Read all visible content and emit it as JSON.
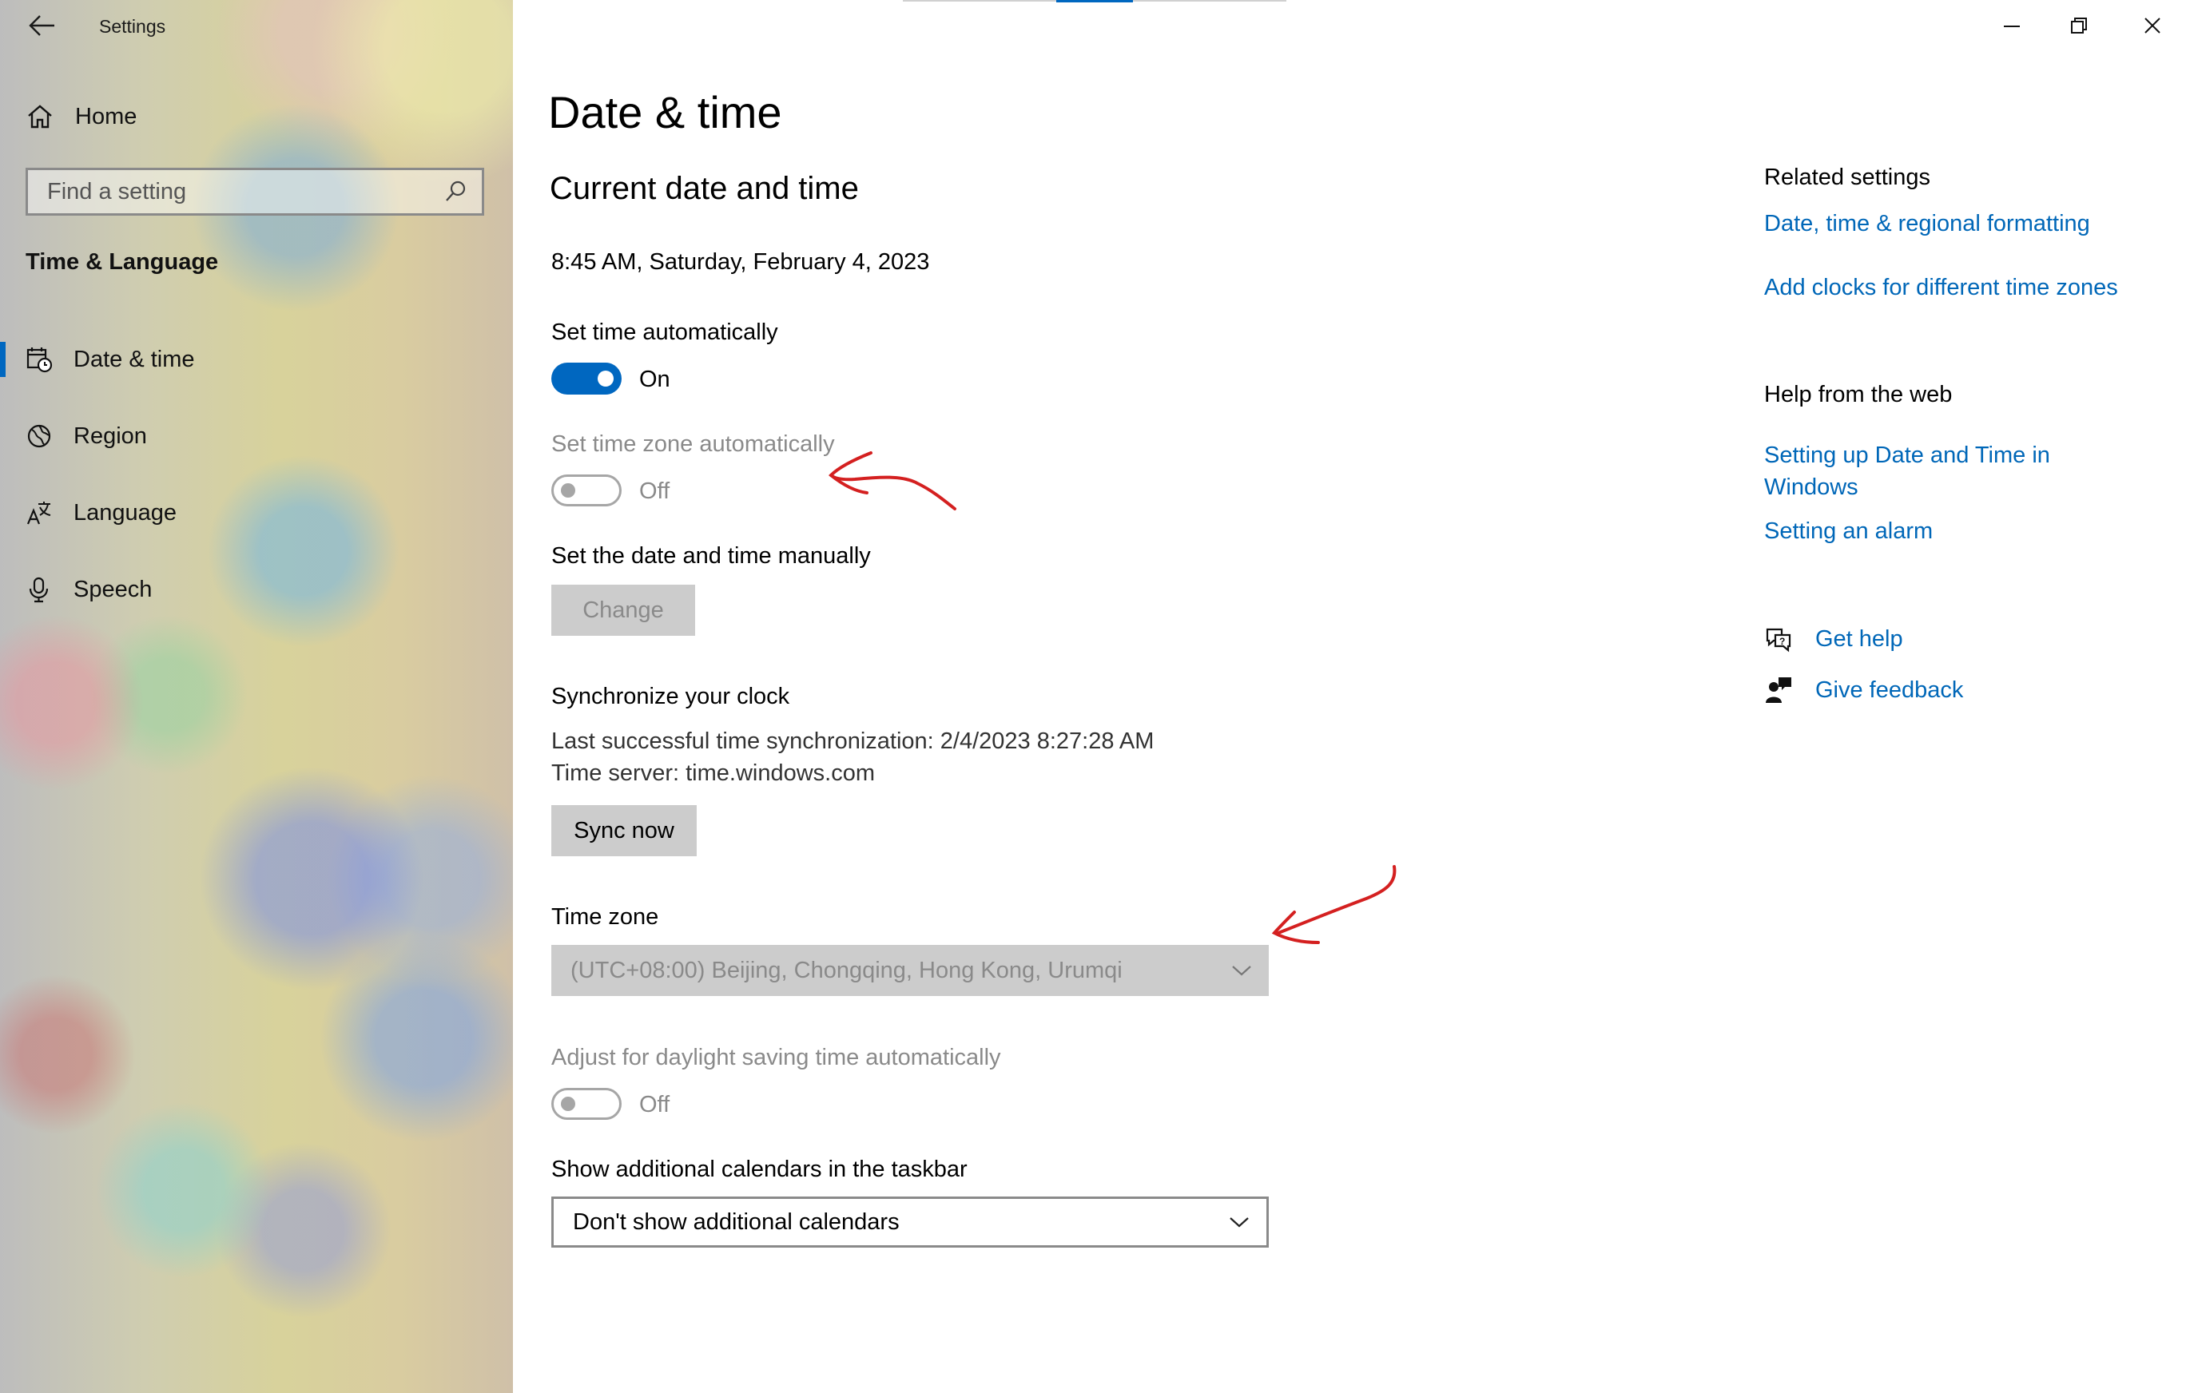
{
  "window": {
    "app_title": "Settings",
    "controls": [
      "minimize-icon",
      "restore-icon",
      "close-icon"
    ]
  },
  "sidebar": {
    "home_label": "Home",
    "search_placeholder": "Find a setting",
    "section_label": "Time & Language",
    "items": [
      {
        "label": "Date & time",
        "icon": "calendar-clock-icon",
        "active": true
      },
      {
        "label": "Region",
        "icon": "globe-icon",
        "active": false
      },
      {
        "label": "Language",
        "icon": "language-icon",
        "active": false
      },
      {
        "label": "Speech",
        "icon": "microphone-icon",
        "active": false
      }
    ]
  },
  "main": {
    "title": "Date & time",
    "subtitle": "Current date and time",
    "current_datetime": "8:45 AM, Saturday, February 4, 2023",
    "set_time_auto": {
      "label": "Set time automatically",
      "state_label": "On"
    },
    "set_tz_auto": {
      "label": "Set time zone automatically",
      "state_label": "Off"
    },
    "manual": {
      "label": "Set the date and time manually",
      "button": "Change"
    },
    "sync": {
      "label": "Synchronize your clock",
      "last_sync": "Last successful time synchronization: 2/4/2023 8:27:28 AM",
      "server": "Time server: time.windows.com",
      "button": "Sync now"
    },
    "timezone": {
      "label": "Time zone",
      "value": "(UTC+08:00) Beijing, Chongqing, Hong Kong, Urumqi"
    },
    "dst": {
      "label": "Adjust for daylight saving time automatically",
      "state_label": "Off"
    },
    "calendars": {
      "label": "Show additional calendars in the taskbar",
      "value": "Don't show additional calendars"
    }
  },
  "right": {
    "related_heading": "Related settings",
    "related_links": [
      "Date, time & regional formatting",
      "Add clocks for different time zones"
    ],
    "help_heading": "Help from the web",
    "help_link_1_line1": "Setting up Date and Time in",
    "help_link_1_line2": "Windows",
    "help_link_2": "Setting an alarm",
    "get_help": "Get help",
    "give_feedback": "Give feedback"
  },
  "colors": {
    "accent": "#0067c0",
    "link": "#0067b8",
    "disabled_text": "#8a8a8a",
    "button_bg": "#cccccc",
    "annotation": "#d42020"
  }
}
